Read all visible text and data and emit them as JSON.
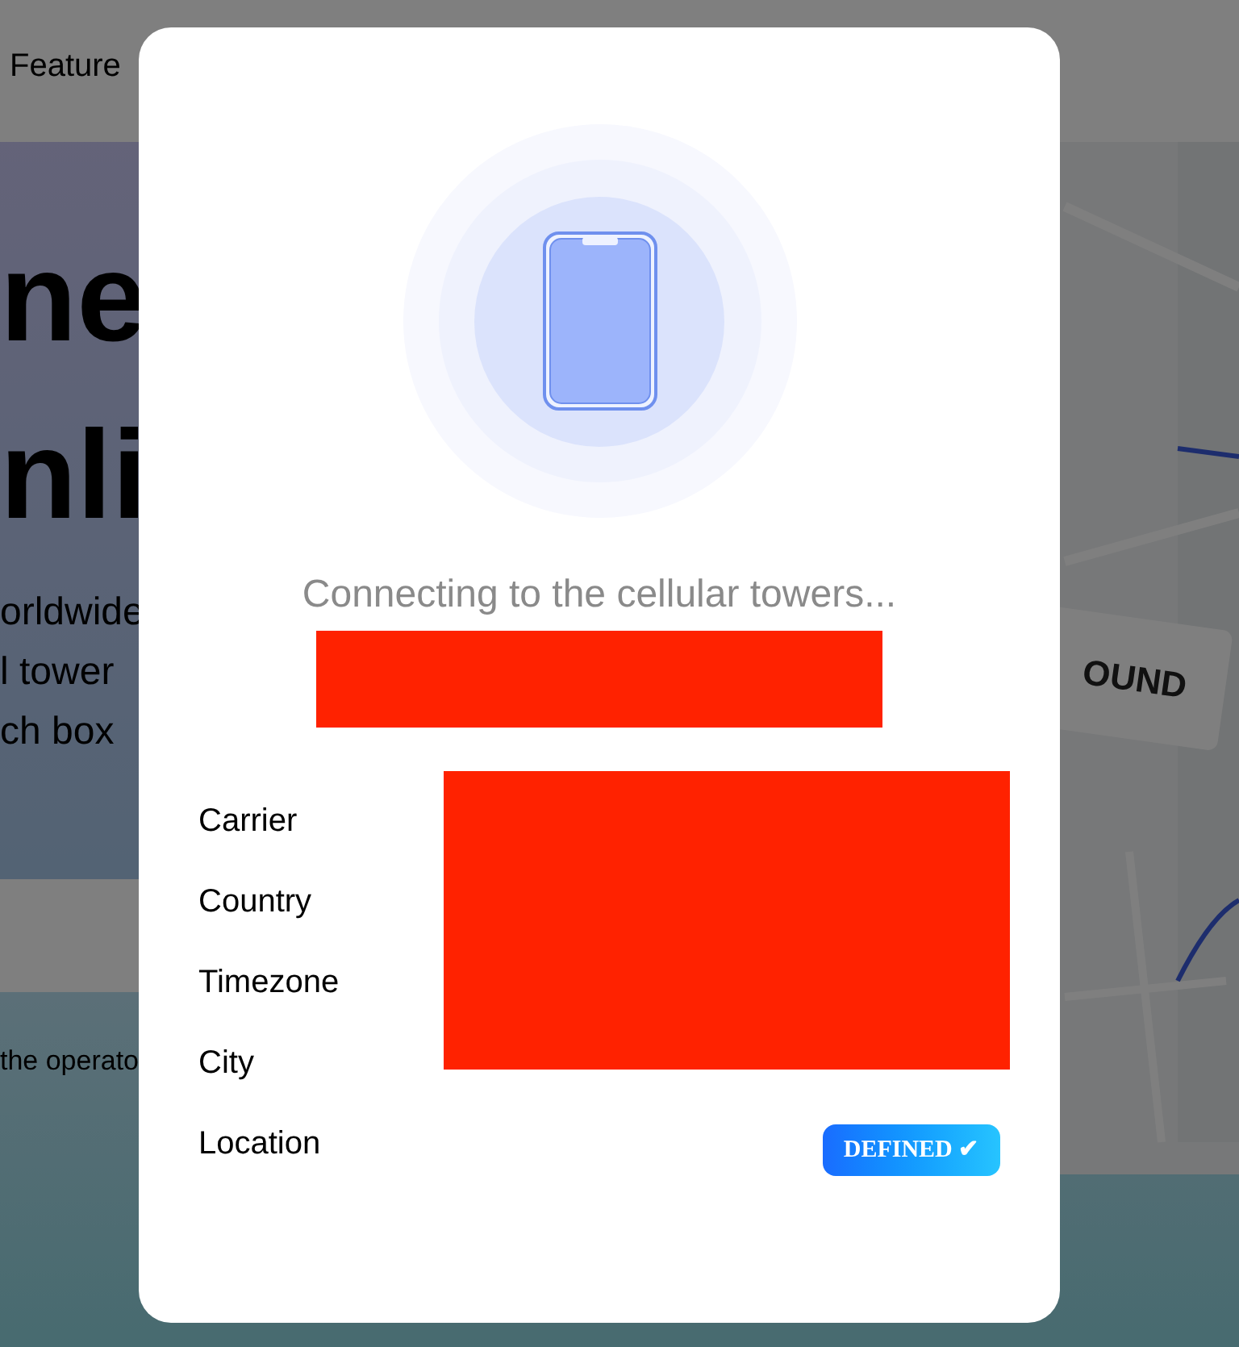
{
  "background_page": {
    "nav_link": "Feature",
    "heading_lines": [
      "ne",
      "nli"
    ],
    "text_lines": [
      "orldwide",
      "l tower",
      "ch box"
    ],
    "caption": "the operato",
    "stamp": "OUND",
    "map": {
      "kind": "picture"
    }
  },
  "dialog": {
    "status": "Connecting to the cellular towers...",
    "fields": [
      {
        "label": "Carrier"
      },
      {
        "label": "Country"
      },
      {
        "label": "Timezone"
      },
      {
        "label": "City"
      },
      {
        "label": "Location",
        "badge": "DEFINED ✔"
      }
    ]
  }
}
